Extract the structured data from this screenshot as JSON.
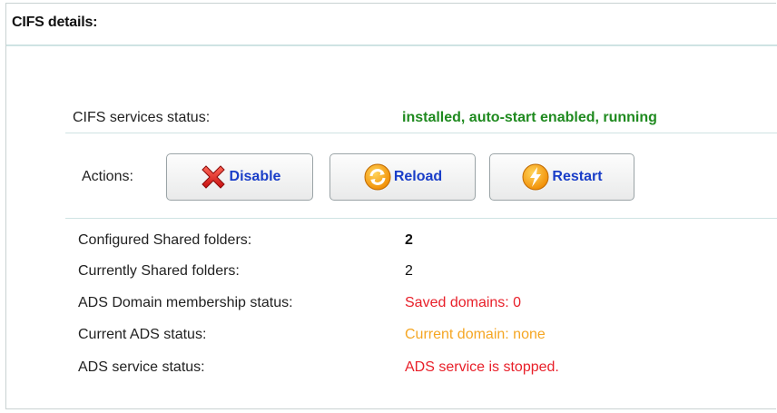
{
  "panel": {
    "title": "CIFS details:"
  },
  "status": {
    "label": "CIFS services status:",
    "value": "installed, auto-start enabled, running",
    "value_color": "#1f8a1f"
  },
  "actions": {
    "label": "Actions:",
    "buttons": [
      {
        "label": "Disable",
        "icon": "red-x-icon"
      },
      {
        "label": "Reload",
        "icon": "reload-arrows-icon"
      },
      {
        "label": "Restart",
        "icon": "lightning-icon"
      }
    ],
    "button_text_color": "#1a3ec8"
  },
  "details": [
    {
      "label": "Configured Shared folders:",
      "value": "2"
    },
    {
      "label": "Currently Shared folders:",
      "value": "2"
    },
    {
      "label": "ADS Domain membership status:",
      "value": "Saved domains: 0",
      "color": "#e8202a"
    },
    {
      "label": "Current ADS status:",
      "value": "Current domain: none",
      "color": "#f5a623"
    },
    {
      "label": "ADS service status:",
      "value": "ADS service is stopped.",
      "color": "#e8202a"
    }
  ]
}
